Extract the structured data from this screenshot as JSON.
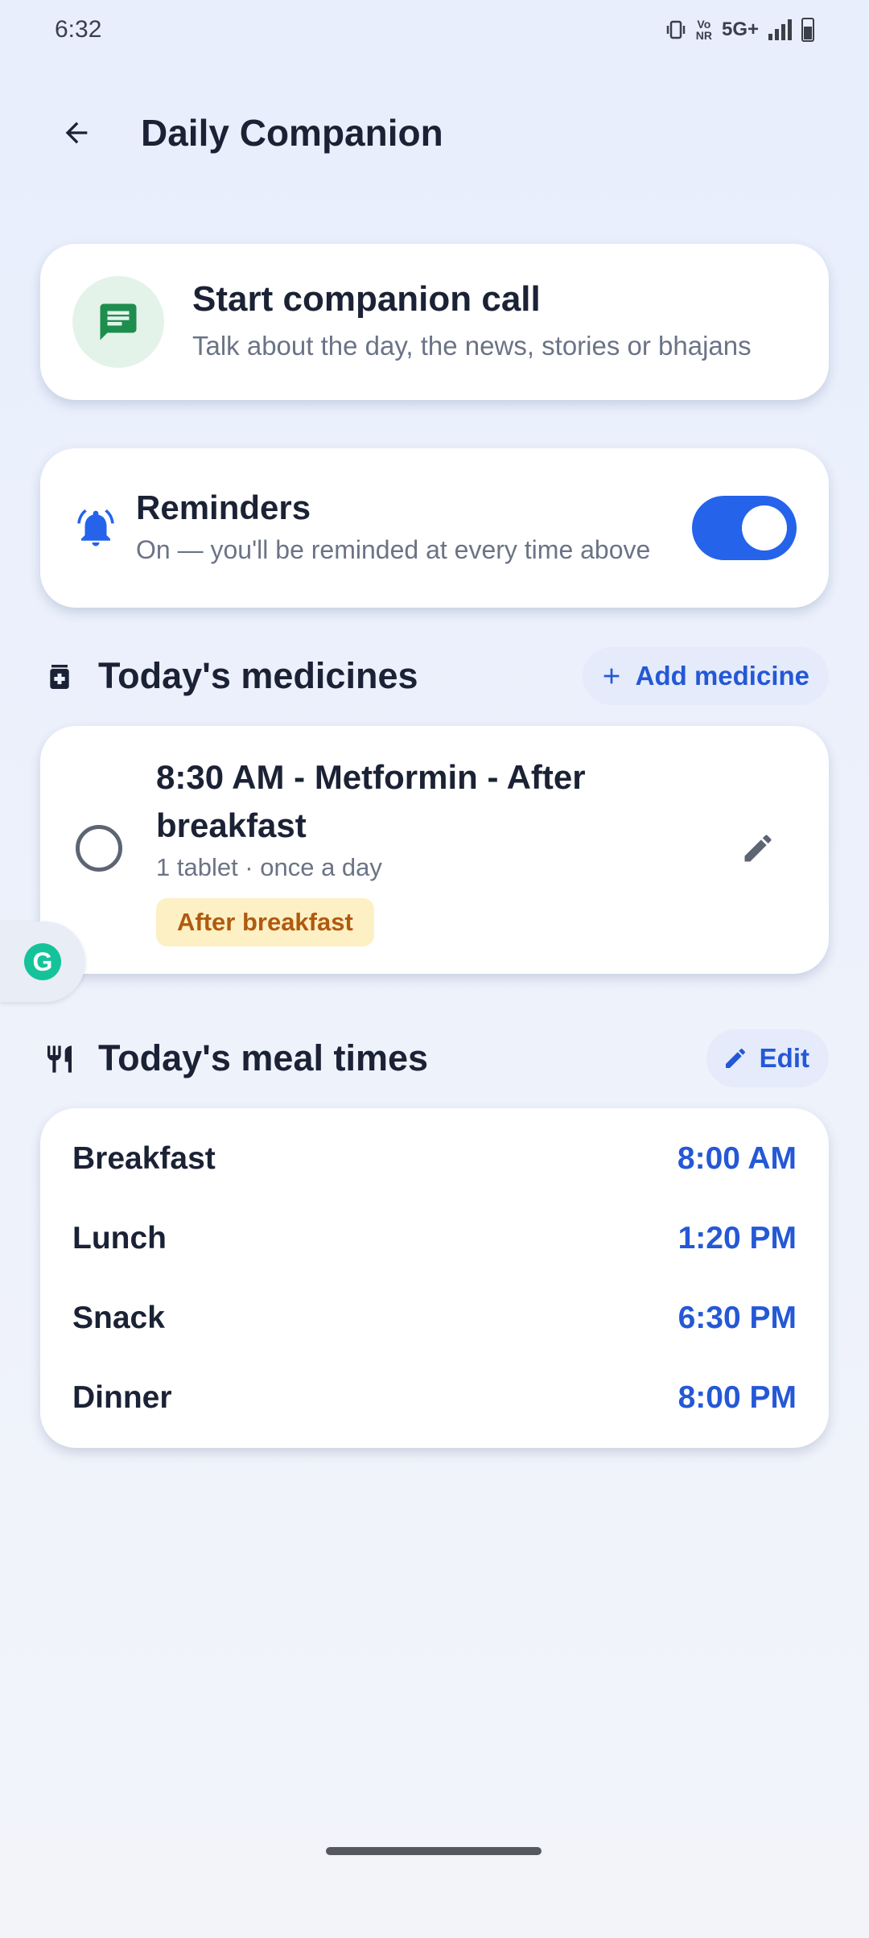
{
  "status_bar": {
    "time": "6:32",
    "volte": "Vo",
    "nr": "NR",
    "network": "5G+"
  },
  "app_bar": {
    "title": "Daily Companion"
  },
  "companion_call": {
    "title": "Start companion call",
    "subtitle": "Talk about the day, the news, stories or bhajans",
    "icon": "chat-icon"
  },
  "reminders": {
    "title": "Reminders",
    "subtitle": "On — you'll be reminded at every time above",
    "enabled": true
  },
  "medicines_section": {
    "title": "Today's medicines",
    "add_label": "Add medicine"
  },
  "medicines": [
    {
      "title": "8:30 AM - Metformin - After breakfast",
      "dosage": "1 tablet · once a day",
      "tag": "After breakfast",
      "taken": false
    }
  ],
  "meals_section": {
    "title": "Today's meal times",
    "edit_label": "Edit"
  },
  "meals": [
    {
      "name": "Breakfast",
      "time": "8:00 AM"
    },
    {
      "name": "Lunch",
      "time": "1:20 PM"
    },
    {
      "name": "Snack",
      "time": "6:30 PM"
    },
    {
      "name": "Dinner",
      "time": "8:00 PM"
    }
  ],
  "colors": {
    "accent": "#2563eb",
    "accent_text": "#2458d6",
    "tag_bg": "#fdf0c4",
    "tag_text": "#b05a0f",
    "call_icon": "#1e8e4e"
  }
}
